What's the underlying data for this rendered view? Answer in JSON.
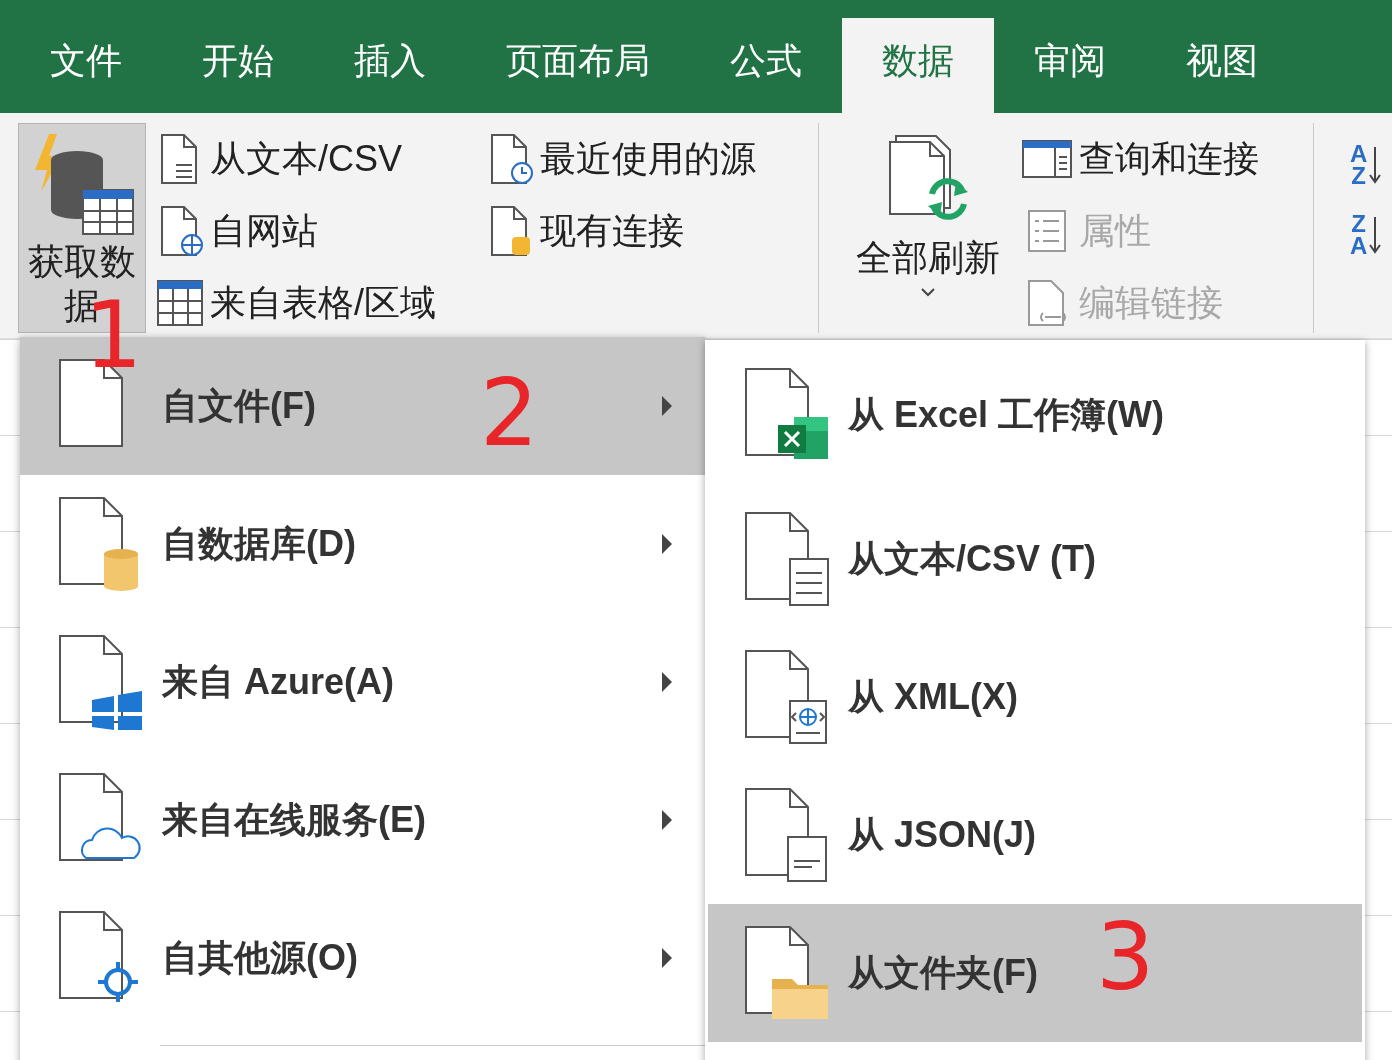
{
  "tabs": [
    {
      "label": "文件",
      "selected": false
    },
    {
      "label": "开始",
      "selected": false
    },
    {
      "label": "插入",
      "selected": false
    },
    {
      "label": "页面布局",
      "selected": false
    },
    {
      "label": "公式",
      "selected": false
    },
    {
      "label": "数据",
      "selected": true
    },
    {
      "label": "审阅",
      "selected": false
    },
    {
      "label": "视图",
      "selected": false
    }
  ],
  "ribbon": {
    "get_data": {
      "label": "获取数据",
      "selected": true
    },
    "source_items": [
      {
        "kind": "text",
        "label": "从文本/CSV"
      },
      {
        "kind": "web",
        "label": "自网站"
      },
      {
        "kind": "table",
        "label": "来自表格/区域"
      },
      {
        "kind": "recent",
        "label": "最近使用的源"
      },
      {
        "kind": "existing",
        "label": "现有连接"
      }
    ],
    "refresh_all": {
      "label": "全部刷新"
    },
    "query_items": [
      {
        "kind": "query",
        "label": "查询和连接",
        "disabled": false
      },
      {
        "kind": "properties",
        "label": "属性",
        "disabled": true
      },
      {
        "kind": "links",
        "label": "编辑链接",
        "disabled": true
      }
    ],
    "sort_buttons": [
      {
        "letters": [
          "A",
          "Z"
        ]
      },
      {
        "letters": [
          "Z",
          "A"
        ]
      }
    ]
  },
  "menu": {
    "items": [
      {
        "kind": "file",
        "label": "自文件(F)",
        "selected": true,
        "has_submenu": true
      },
      {
        "kind": "database",
        "label": "自数据库(D)",
        "selected": false,
        "has_submenu": true
      },
      {
        "kind": "azure",
        "label": "来自 Azure(A)",
        "selected": false,
        "has_submenu": true
      },
      {
        "kind": "online",
        "label": "来自在线服务(E)",
        "selected": false,
        "has_submenu": true
      },
      {
        "kind": "other",
        "label": "自其他源(O)",
        "selected": false,
        "has_submenu": true
      }
    ]
  },
  "submenu": {
    "items": [
      {
        "kind": "excel",
        "label": "从 Excel 工作簿(W)",
        "selected": false
      },
      {
        "kind": "text",
        "label": "从文本/CSV (T)",
        "selected": false
      },
      {
        "kind": "xml",
        "label": "从 XML(X)",
        "selected": false
      },
      {
        "kind": "json",
        "label": "从 JSON(J)",
        "selected": false
      },
      {
        "kind": "folder",
        "label": "从文件夹(F)",
        "selected": true
      }
    ]
  },
  "annotations": [
    {
      "text": "1"
    },
    {
      "text": "2"
    },
    {
      "text": "3"
    }
  ]
}
